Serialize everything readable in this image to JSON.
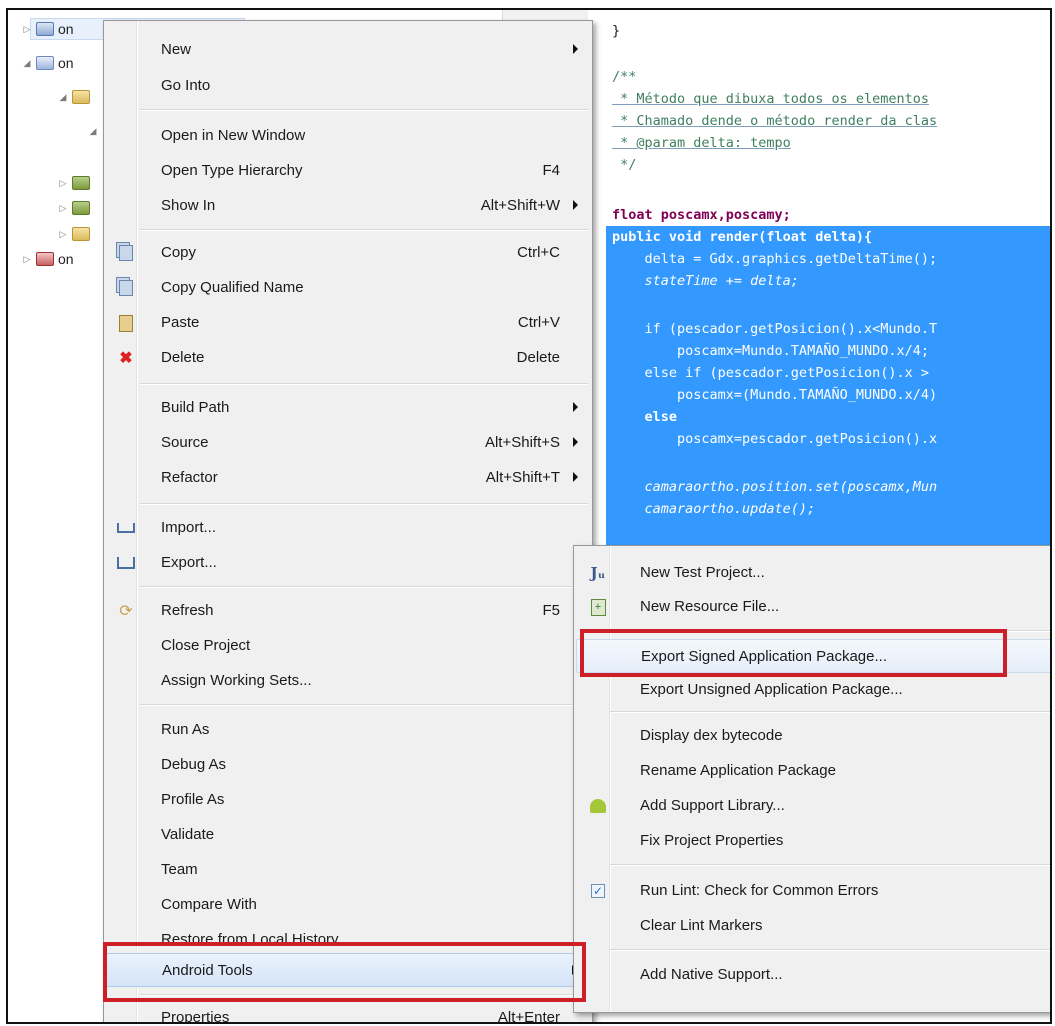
{
  "tree": {
    "rows": [
      {
        "toggle": "▷",
        "label": "on"
      },
      {
        "toggle": "◢",
        "label": "on"
      },
      {
        "toggle": "◢",
        "label": ""
      },
      {
        "toggle": "◢",
        "label": ""
      },
      {
        "toggle": "▷",
        "label": ""
      },
      {
        "toggle": "▷",
        "label": ""
      },
      {
        "toggle": "▷",
        "label": ""
      },
      {
        "toggle": "▷",
        "label": "on"
      }
    ]
  },
  "editor": {
    "lines": [
      "}",
      "",
      "/**",
      " * Método que dibuxa todos os elementos",
      " * Chamado dende o método render da clas",
      " * @param delta: tempo",
      " */",
      "",
      "float poscamx,poscamy;",
      "public void render(float delta){",
      "    delta = Gdx.graphics.getDeltaTime();",
      "    stateTime += delta;",
      "",
      "    if (pescador.getPosicion().x<Mundo.T",
      "        poscamx=Mundo.TAMAÑO_MUNDO.x/4;",
      "    else if (pescador.getPosicion().x >",
      "        poscamx=(Mundo.TAMAÑO_MUNDO.x/4)",
      "    else",
      "        poscamx=pescador.getPosicion().x",
      "",
      "    camaraortho.position.set(poscamx,Mun",
      "    camaraortho.update();"
    ]
  },
  "main_menu": {
    "items": [
      {
        "label": "New",
        "accel": "",
        "submenu": true
      },
      {
        "label": "Go Into",
        "accel": "",
        "submenu": false
      },
      {
        "label": "Open in New Window",
        "accel": "",
        "submenu": false
      },
      {
        "label": "Open Type Hierarchy",
        "accel": "F4",
        "submenu": false
      },
      {
        "label": "Show In",
        "accel": "Alt+Shift+W",
        "submenu": true
      },
      {
        "label": "Copy",
        "accel": "Ctrl+C",
        "submenu": false,
        "icon": "copy-icon"
      },
      {
        "label": "Copy Qualified Name",
        "accel": "",
        "submenu": false,
        "icon": "copy-qualified-name-icon"
      },
      {
        "label": "Paste",
        "accel": "Ctrl+V",
        "submenu": false,
        "icon": "paste-icon"
      },
      {
        "label": "Delete",
        "accel": "Delete",
        "submenu": false,
        "icon": "delete-icon"
      },
      {
        "label": "Build Path",
        "accel": "",
        "submenu": true
      },
      {
        "label": "Source",
        "accel": "Alt+Shift+S",
        "submenu": true
      },
      {
        "label": "Refactor",
        "accel": "Alt+Shift+T",
        "submenu": true
      },
      {
        "label": "Import...",
        "accel": "",
        "submenu": false,
        "icon": "import-icon"
      },
      {
        "label": "Export...",
        "accel": "",
        "submenu": false,
        "icon": "export-icon"
      },
      {
        "label": "Refresh",
        "accel": "F5",
        "submenu": false,
        "icon": "refresh-icon"
      },
      {
        "label": "Close Project",
        "accel": "",
        "submenu": false
      },
      {
        "label": "Assign Working Sets...",
        "accel": "",
        "submenu": false
      },
      {
        "label": "Run As",
        "accel": "",
        "submenu": true
      },
      {
        "label": "Debug As",
        "accel": "",
        "submenu": true
      },
      {
        "label": "Profile As",
        "accel": "",
        "submenu": true
      },
      {
        "label": "Validate",
        "accel": "",
        "submenu": false
      },
      {
        "label": "Team",
        "accel": "",
        "submenu": true
      },
      {
        "label": "Compare With",
        "accel": "",
        "submenu": true
      },
      {
        "label": "Restore from Local History...",
        "accel": "",
        "submenu": false
      },
      {
        "label": "Android Tools",
        "accel": "",
        "submenu": true
      },
      {
        "label": "Properties",
        "accel": "Alt+Enter",
        "submenu": false
      }
    ]
  },
  "android_tools_menu": {
    "items": [
      {
        "label": "New Test Project...",
        "icon": "junit-icon"
      },
      {
        "label": "New Resource File...",
        "icon": "new-resource-file-icon"
      },
      {
        "label": "Export Signed Application Package...",
        "icon": ""
      },
      {
        "label": "Export Unsigned Application Package...",
        "icon": ""
      },
      {
        "label": "Display dex bytecode",
        "icon": ""
      },
      {
        "label": "Rename Application Package",
        "icon": ""
      },
      {
        "label": "Add Support Library...",
        "icon": "android-icon"
      },
      {
        "label": "Fix Project Properties",
        "icon": ""
      },
      {
        "label": "Run Lint: Check for Common Errors",
        "icon": "lint-check-icon"
      },
      {
        "label": "Clear Lint Markers",
        "icon": ""
      },
      {
        "label": "Add Native Support...",
        "icon": ""
      }
    ]
  },
  "colors": {
    "callout": "#cc1f27",
    "code_selection": "#3399ff",
    "menu_background": "#f0f0f0"
  }
}
